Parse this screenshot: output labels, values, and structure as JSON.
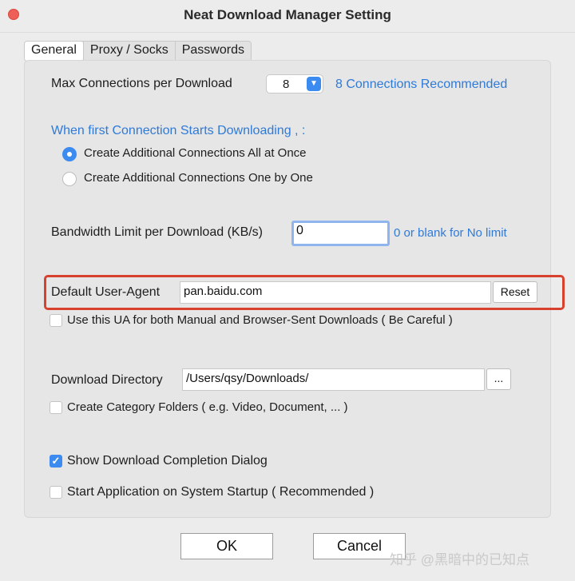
{
  "window": {
    "title": "Neat Download Manager Setting"
  },
  "tabs": [
    {
      "label": "General",
      "active": true
    },
    {
      "label": "Proxy / Socks",
      "active": false
    },
    {
      "label": "Passwords",
      "active": false
    }
  ],
  "connections": {
    "label": "Max Connections  per Download",
    "value": "8",
    "note": "8 Connections Recommended"
  },
  "first_connection": {
    "heading": "When first Connection Starts Downloading   , :",
    "options": [
      {
        "label": "Create Additional Connections All at Once",
        "selected": true
      },
      {
        "label": "Create Additional Connections One by One",
        "selected": false
      }
    ]
  },
  "bandwidth": {
    "label": "Bandwidth Limit per Download (KB/s)",
    "value": "0",
    "note": "0 or blank for No limit"
  },
  "user_agent": {
    "label": "Default User-Agent",
    "value": "pan.baidu.com",
    "reset_label": "Reset",
    "checkbox_label": "Use this UA for both Manual and Browser-Sent Downloads ( Be Careful )",
    "checkbox_checked": false
  },
  "download_dir": {
    "label": "Download Directory",
    "value": "/Users/qsy/Downloads/",
    "browse_label": "...",
    "category_label": "Create Category Folders ( e.g.  Video, Document, ...  )",
    "category_checked": false
  },
  "options": {
    "completion_label": "Show Download Completion Dialog",
    "completion_checked": true,
    "startup_label": "Start Application on System Startup ( Recommended )",
    "startup_checked": false
  },
  "buttons": {
    "ok": "OK",
    "cancel": "Cancel"
  },
  "watermark": "知乎 @黑暗中的已知点",
  "colors": {
    "accent": "#3b8bf0",
    "link": "#2f7ad8",
    "highlight": "#d9412f",
    "close": "#ee5f57"
  }
}
